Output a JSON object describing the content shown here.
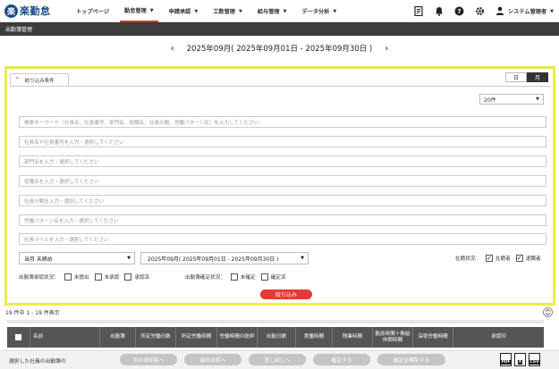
{
  "header": {
    "logo_mark": "楽",
    "logo_text": "楽勤怠",
    "nav": [
      {
        "label": "トップページ",
        "caret": false,
        "active": false
      },
      {
        "label": "勤怠管理",
        "caret": true,
        "active": true
      },
      {
        "label": "申請承認",
        "caret": true,
        "active": false
      },
      {
        "label": "工数管理",
        "caret": true,
        "active": false
      },
      {
        "label": "給与管理",
        "caret": true,
        "active": false
      },
      {
        "label": "データ分析",
        "caret": true,
        "active": false
      }
    ],
    "user_label": "システム管理者",
    "icons": [
      "document-icon",
      "bell-icon",
      "help-icon",
      "gear-icon",
      "user-icon"
    ]
  },
  "page_title": "出勤簿管理",
  "period": {
    "label": "2025年09月( 2025年09月01日 - 2025年09月30日 )",
    "prev": "‹",
    "next": "›"
  },
  "filter": {
    "tab_label": "絞り込み条件",
    "view_toggle": [
      "日",
      "月"
    ],
    "view_selected": "月",
    "per_page": "20件",
    "fields": [
      "検索キーワード（社員名、社員番号、部門名、役職名、社員分類、労働パターン名）を入力してください",
      "社員名や社員番号を入力・選択してください",
      "部門名を入力・選択してください",
      "役職名を入力・選択してください",
      "社員分類を入力・選択してください",
      "労働パターン名を入力・選択してください",
      "社員ラベルを入力・選択してください"
    ],
    "closing_select": "当月 末締め",
    "period_select": "2025年09月( 2025年09月01日 - 2025年09月30日 )",
    "enrollment_label": "在籍状況：",
    "enrollment_options": [
      {
        "label": "在籍者",
        "checked": true
      },
      {
        "label": "退職者",
        "checked": true
      }
    ],
    "approval_label": "出勤簿承認状況：",
    "approval_options": [
      {
        "label": "未提出",
        "checked": false
      },
      {
        "label": "未承認",
        "checked": false
      },
      {
        "label": "承認済",
        "checked": false
      }
    ],
    "confirm_label": "出勤簿確定状況：",
    "confirm_options": [
      {
        "label": "未確定",
        "checked": false
      },
      {
        "label": "確定済",
        "checked": false
      }
    ],
    "submit_label": "絞り込み"
  },
  "results": {
    "count_text": "19 件中 1 - 19 件表示",
    "columns": [
      "名前",
      "出勤簿",
      "所定労働日数",
      "所定労働時間",
      "労働時間の総枠",
      "出勤日数",
      "実働時間",
      "残業時間",
      "勤怠時間＋無給休暇時間",
      "深夜労働時間",
      "承認印"
    ]
  },
  "footer": {
    "label": "選択した社員の出勤簿の",
    "buttons": [
      "次の承認者へ",
      "最終承認へ",
      "差し戻しへ",
      "確定する",
      "確定を解除する"
    ],
    "exports": [
      "PDF",
      "CSV"
    ]
  }
}
